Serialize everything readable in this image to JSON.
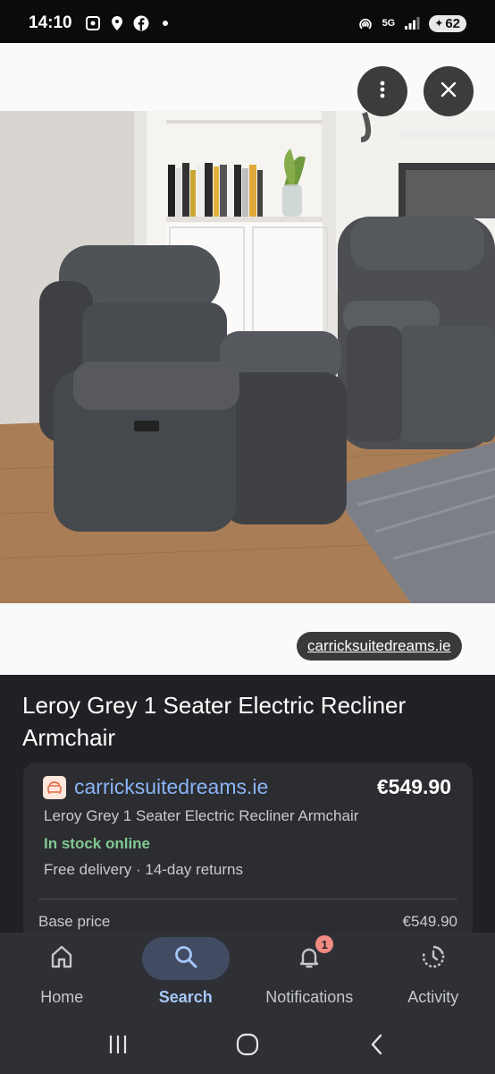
{
  "status_bar": {
    "time": "14:10",
    "left_icons": [
      "screenshot-icon",
      "location-pin-icon",
      "facebook-icon",
      "dot-icon"
    ],
    "network": "5G",
    "battery": "62"
  },
  "image_viewer": {
    "image_alt": "Grey recliner armchairs in a living room",
    "source_link": "carricksuitedreams.ie",
    "more_icon": "more-vert-icon",
    "close_icon": "close-icon"
  },
  "product": {
    "title": "Leroy Grey 1 Seater Electric Recliner Armchair",
    "offer": {
      "store": "carricksuitedreams.ie",
      "price": "€549.90",
      "item_title": "Leroy Grey 1 Seater Electric Recliner Armchair",
      "stock": "In stock online",
      "delivery": "Free delivery · 14-day returns",
      "base_price_label": "Base price",
      "base_price_value": "€549.90"
    }
  },
  "bottom_nav": {
    "items": [
      {
        "label": "Home",
        "icon": "home-icon"
      },
      {
        "label": "Search",
        "icon": "search-icon",
        "active": true
      },
      {
        "label": "Notifications",
        "icon": "bell-icon",
        "badge": "1"
      },
      {
        "label": "Activity",
        "icon": "activity-icon"
      }
    ]
  },
  "colors": {
    "accent": "#8ab4f8",
    "stock_green": "#81c995",
    "panel_bg": "#202124",
    "nav_bg": "#2e3036"
  }
}
